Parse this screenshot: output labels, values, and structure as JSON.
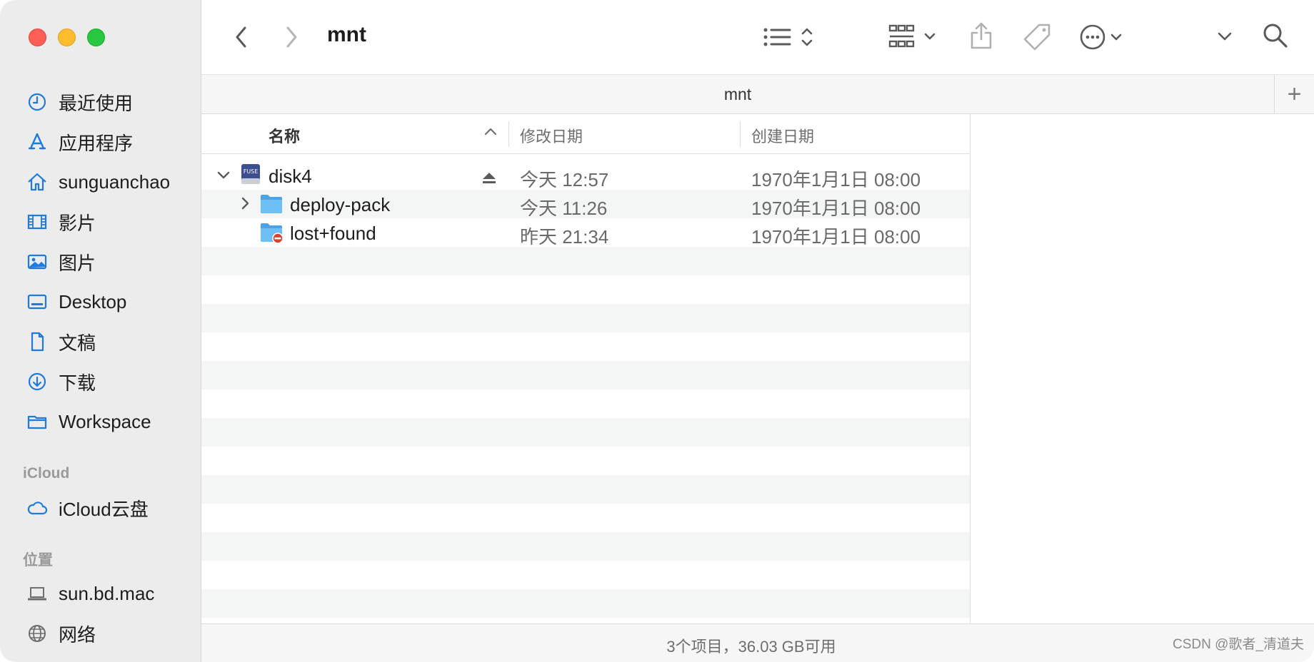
{
  "window": {
    "title": "mnt"
  },
  "sidebar": {
    "favorites": [
      {
        "label": "最近使用",
        "icon": "clock-icon"
      },
      {
        "label": "应用程序",
        "icon": "applications-icon"
      },
      {
        "label": "sunguanchao",
        "icon": "home-icon"
      },
      {
        "label": "影片",
        "icon": "film-icon"
      },
      {
        "label": "图片",
        "icon": "photo-icon"
      },
      {
        "label": "Desktop",
        "icon": "desktop-icon"
      },
      {
        "label": "文稿",
        "icon": "document-icon"
      },
      {
        "label": "下载",
        "icon": "download-icon"
      },
      {
        "label": "Workspace",
        "icon": "folder-icon"
      }
    ],
    "icloud_heading": "iCloud",
    "icloud": [
      {
        "label": "iCloud云盘",
        "icon": "cloud-icon"
      }
    ],
    "locations_heading": "位置",
    "locations": [
      {
        "label": "sun.bd.mac",
        "icon": "laptop-icon"
      },
      {
        "label": "网络",
        "icon": "globe-icon"
      }
    ]
  },
  "tabbar": {
    "title": "mnt",
    "add_label": "+"
  },
  "columns": {
    "name": "名称",
    "modified": "修改日期",
    "created": "创建日期"
  },
  "rows": [
    {
      "name": "disk4",
      "modified": "今天 12:57",
      "created": "1970年1月1日 08:00",
      "icon": "fuse-disk-icon",
      "expanded": true,
      "level": 0
    },
    {
      "name": "deploy-pack",
      "modified": "今天 11:26",
      "created": "1970年1月1日 08:00",
      "icon": "folder-icon",
      "expanded": false,
      "level": 1
    },
    {
      "name": "lost+found",
      "modified": "昨天 21:34",
      "created": "1970年1月1日 08:00",
      "icon": "restricted-folder-icon",
      "level": 1
    }
  ],
  "status": {
    "text": "3个项目，36.03 GB可用"
  },
  "watermark": "CSDN @歌者_清道夫",
  "colors": {
    "accent": "#1f7ae0",
    "folder": "#5db3f0"
  }
}
